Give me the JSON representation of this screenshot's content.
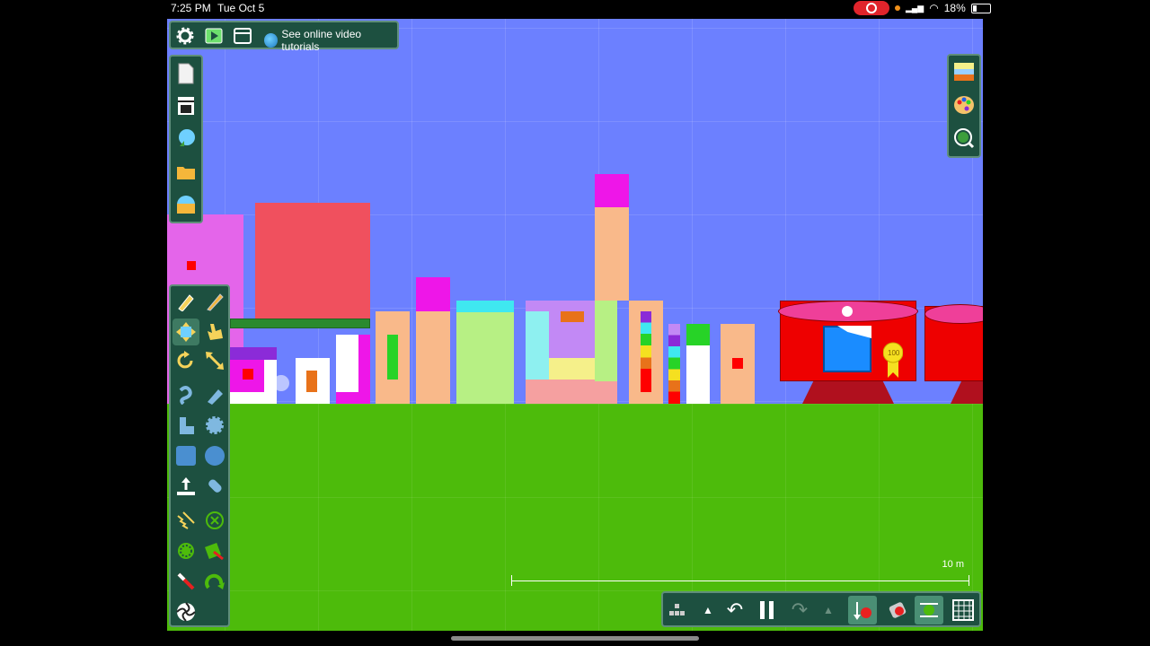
{
  "status_bar": {
    "time": "7:25 PM",
    "date": "Tue Oct 5",
    "battery": "18%"
  },
  "top_toolbar": {
    "tutorial_label": "See online video tutorials"
  },
  "scale_bar": {
    "label": "10 m"
  },
  "colors": {
    "sky": "#6c80ff",
    "ground": "#4dbb0b",
    "panel": "#1d5040",
    "panel_border": "#5f8e7a"
  },
  "left_menu": {
    "icons": [
      "new-file-icon",
      "scene-icon",
      "download-scene-icon",
      "open-folder-icon",
      "save-icon"
    ]
  },
  "tool_palette": {
    "icons": [
      "sketch-icon",
      "knife-icon",
      "move-icon",
      "drag-hand-icon",
      "rotate-icon",
      "scale-icon",
      "rope-icon",
      "thruster-icon",
      "polygon-icon",
      "gear-shape-icon",
      "box-icon",
      "circle-icon",
      "plane-icon",
      "chain-icon",
      "spring-icon",
      "fixate-icon",
      "axle-icon",
      "tracer-icon",
      "laser-icon",
      "hinge-icon",
      "texture-icon"
    ]
  },
  "right_menu": {
    "icons": [
      "background-icon",
      "palette-icon",
      "zoom-to-fit-icon"
    ]
  },
  "bottom_bar": {
    "icons": [
      "blocks-icon",
      "collapse-arrow-icon",
      "undo-icon",
      "pause-icon",
      "redo-icon",
      "expand-arrow-icon",
      "gravity-icon",
      "apple-icon",
      "camera-follow-icon",
      "grid-icon"
    ]
  }
}
